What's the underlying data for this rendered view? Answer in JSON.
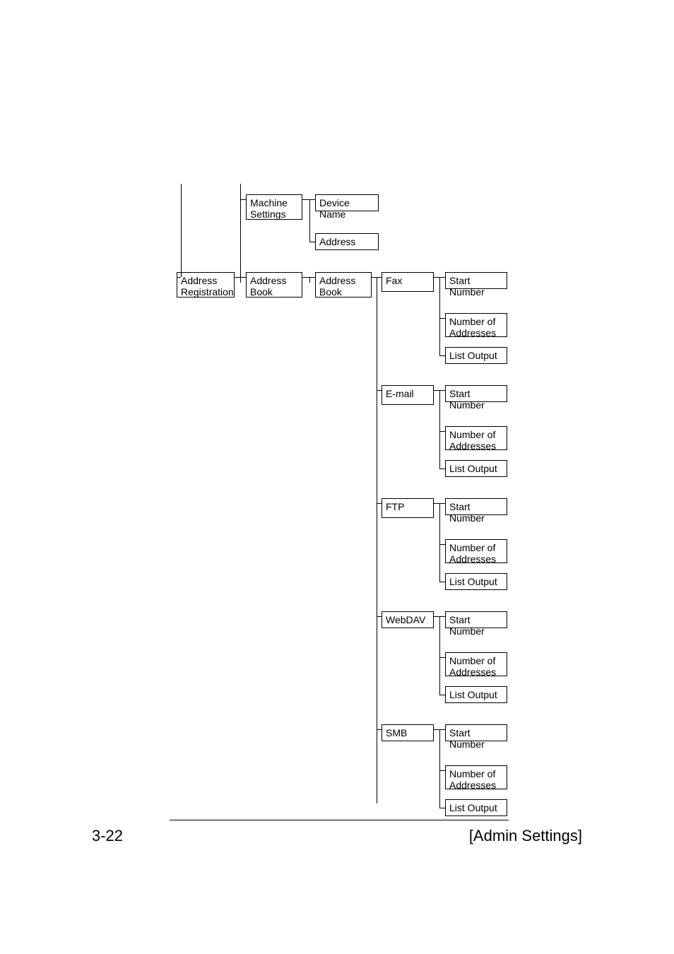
{
  "boxes": {
    "machine_settings": "Machine\nSettings",
    "device_name": "Device Name",
    "address_top": "Address",
    "address_registration": "Address\nRegistration",
    "address_book_1": "Address\nBook",
    "address_book_2": "Address\nBook",
    "fax": "Fax",
    "email": "E-mail",
    "ftp": "FTP",
    "webdav": "WebDAV",
    "smb": "SMB",
    "start_number": "Start Number",
    "number_of_addresses": "Number of\nAddresses",
    "list_output": "List Output"
  },
  "footer": {
    "page": "3-22",
    "section": "[Admin Settings]"
  }
}
